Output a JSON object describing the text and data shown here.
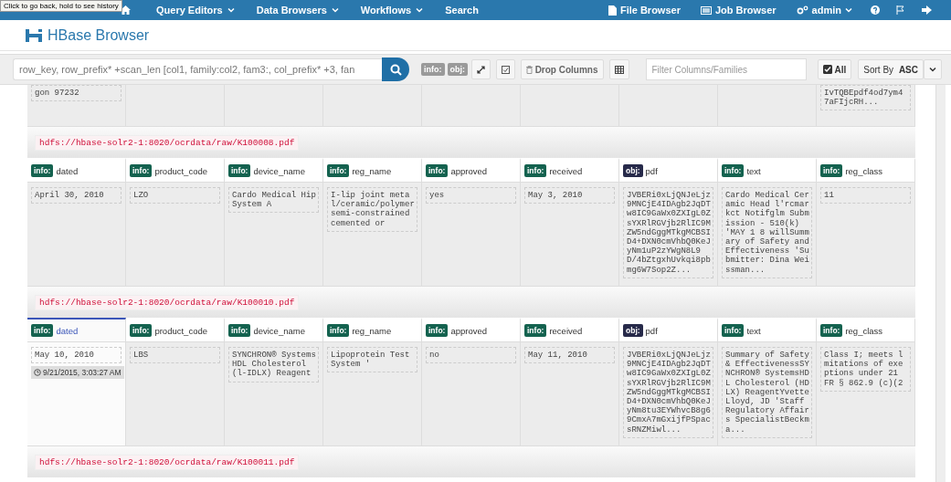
{
  "tooltip": "Click to go back, hold to see history",
  "nav": {
    "left": [
      {
        "label": "Query Editors",
        "dropdown": true
      },
      {
        "label": "Data Browsers",
        "dropdown": true
      },
      {
        "label": "Workflows",
        "dropdown": true
      },
      {
        "label": "Search",
        "dropdown": false
      }
    ],
    "right": [
      {
        "kind": "file",
        "label": "File Browser",
        "dropdown": false
      },
      {
        "kind": "job",
        "label": "Job Browser",
        "dropdown": false
      },
      {
        "kind": "user",
        "label": "admin",
        "dropdown": true
      }
    ]
  },
  "app_title": "HBase Browser",
  "toolbar": {
    "query": "row_key, row_prefix* +scan_len [col1, family:col2, fam3:, col_prefix* +3, fan",
    "tags": [
      "info:",
      "obj:"
    ],
    "drop_columns": "Drop Columns",
    "filter_placeholder": "Filter Columns/Families",
    "all": {
      "label": "All",
      "checked": true
    },
    "sort": {
      "prefix": "Sort By",
      "order": "ASC"
    }
  },
  "top_row": {
    "cells": [
      {
        "text": "gon 97232"
      },
      {},
      {},
      {},
      {},
      {},
      {},
      {},
      {
        "text": "IvTQBEpdf4od7ym4\n7aFIjcRH..."
      }
    ]
  },
  "rows": [
    {
      "key": "hdfs://hbase-solr2-1:8020/ocrdata/raw/K100008.pdf",
      "cells": [
        {
          "kind": "info",
          "family": "info:",
          "column": "dated",
          "value": "April 30, 2010",
          "selected": false
        },
        {
          "kind": "info",
          "family": "info:",
          "column": "product_code",
          "value": "LZO",
          "selected": false
        },
        {
          "kind": "info",
          "family": "info:",
          "column": "device_name",
          "value": "Cardo Medical Hip\nSystem A",
          "selected": false
        },
        {
          "kind": "info",
          "family": "info:",
          "column": "reg_name",
          "value": "I-lip joint meta\nl/ceramic/polymer\nsemi-constrained\ncemented or",
          "selected": false
        },
        {
          "kind": "info",
          "family": "info:",
          "column": "approved",
          "value": "yes",
          "selected": false
        },
        {
          "kind": "info",
          "family": "info:",
          "column": "received",
          "value": "May 3, 2010",
          "selected": false
        },
        {
          "kind": "obj",
          "family": "obj:",
          "column": "pdf",
          "value": "JVBERi0xLjQNJeLjz\n9MNCjE4IDAgb2JqDT\nw8IC9GaWx0ZXIgL0Z\nsYXRlRGVjb2RlIC9M\nZW5ndGggMTkgMCBSI\nD4+DXN0cmVhbQ0KeJ\nyNm1uP2zYWgN8L9\nD/4bZtgxhUvkqi8pb\nmg6W7Sop2Z...",
          "selected": false
        },
        {
          "kind": "info",
          "family": "info:",
          "column": "text",
          "value": "Cardo Medical Cer\namic Head l'rcmar\nkct Notifglm Subm\nission - 510(k)\n'MAY 1 8 willSumm\nary of Safety and\nEffectiveness 'Su\nbmitter: Dina Wei\nssman...",
          "selected": false
        },
        {
          "kind": "info",
          "family": "info:",
          "column": "reg_class",
          "value": "11",
          "selected": false
        }
      ]
    },
    {
      "key": "hdfs://hbase-solr2-1:8020/ocrdata/raw/K100010.pdf",
      "cells": [
        {
          "kind": "info",
          "family": "info:",
          "column": "dated",
          "value": "May 10, 2010",
          "selected": true,
          "timestamp": "9/21/2015, 3:03:27 AM"
        },
        {
          "kind": "info",
          "family": "info:",
          "column": "product_code",
          "value": "LBS",
          "selected": false
        },
        {
          "kind": "info",
          "family": "info:",
          "column": "device_name",
          "value": "SYNCHRON® Systems\nHDL Cholesterol\n(l-IDLX) Reagent",
          "selected": false
        },
        {
          "kind": "info",
          "family": "info:",
          "column": "reg_name",
          "value": "Lipoprotein Test\nSystem '",
          "selected": false
        },
        {
          "kind": "info",
          "family": "info:",
          "column": "approved",
          "value": "no",
          "selected": false
        },
        {
          "kind": "info",
          "family": "info:",
          "column": "received",
          "value": "May 11, 2010",
          "selected": false
        },
        {
          "kind": "obj",
          "family": "obj:",
          "column": "pdf",
          "value": "JVBERi0xLjQNJeLjz\n9MNCjE4IDAgb2JqDT\nw8IC9GaWx0ZXIgL0Z\nsYXRlRGVjb2RlIC9M\nZW5ndGggMTkgMCBSI\nD4+DXN0cmVhbQ0KeJ\nyNm8tu3EYWhvcB8g6\n9CmxA7mGxijfPSpac\nsRNZMiwl...",
          "selected": false
        },
        {
          "kind": "info",
          "family": "info:",
          "column": "text",
          "value": "Summary of Safety\n& EffectivenessSY\nNCHRON® SystemsHD\nL Cholesterol (HD\nLX) ReagentYvette\nLloyd, JD 'Staff\nRegulatory Affair\ns SpecialistBeckm\na...",
          "selected": false
        },
        {
          "kind": "info",
          "family": "info:",
          "column": "reg_class",
          "value": "Class I; meets l\nmitations of exe\nptions under 21\nFR § 862.9 (c)(2",
          "selected": false
        }
      ]
    },
    {
      "key": "hdfs://hbase-solr2-1:8020/ocrdata/raw/K100011.pdf",
      "cells": []
    }
  ]
}
